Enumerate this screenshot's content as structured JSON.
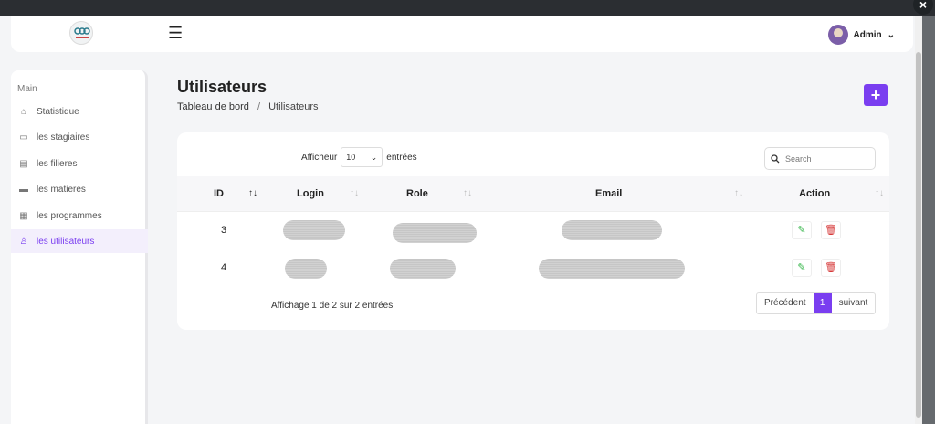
{
  "header": {
    "user_name": "Admin"
  },
  "sidebar": {
    "section": "Main",
    "items": [
      {
        "label": "Statistique",
        "icon": "home-icon"
      },
      {
        "label": "les stagiaires",
        "icon": "id-card-icon"
      },
      {
        "label": "les filieres",
        "icon": "document-icon"
      },
      {
        "label": "les matieres",
        "icon": "book-icon"
      },
      {
        "label": "les programmes",
        "icon": "grid-icon"
      },
      {
        "label": "les utilisateurs",
        "icon": "users-icon",
        "active": true
      }
    ]
  },
  "page": {
    "title": "Utilisateurs",
    "breadcrumb": [
      "Tableau de bord",
      "Utilisateurs"
    ],
    "separator": "/"
  },
  "table_controls": {
    "show_label": "Afficheur",
    "show_value": "10",
    "entries_label": "entrées",
    "search_placeholder": "Search"
  },
  "table": {
    "columns": [
      "ID",
      "Login",
      "Role",
      "Email",
      "Action"
    ],
    "rows": [
      {
        "id": "3"
      },
      {
        "id": "4"
      }
    ]
  },
  "footer": {
    "info": "Affichage 1 de 2 sur 2 entrées",
    "prev": "Précédent",
    "page": "1",
    "next": "suivant"
  },
  "colors": {
    "accent": "#7a3ef0",
    "edit": "#2fb344",
    "delete": "#d63939"
  }
}
